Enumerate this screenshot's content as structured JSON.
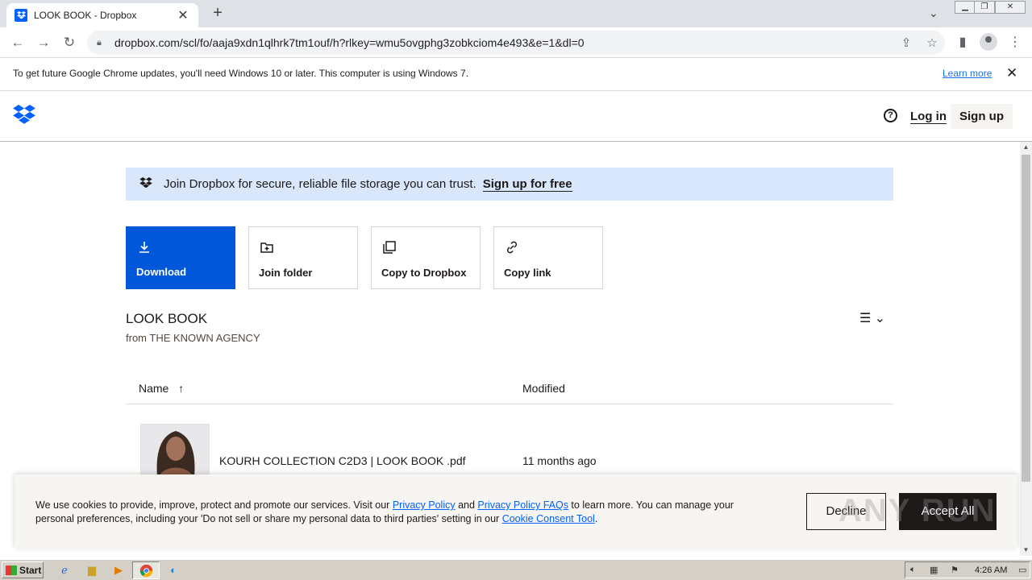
{
  "browser": {
    "tab_title": "LOOK BOOK - Dropbox",
    "tab_close": "✕",
    "new_tab": "+",
    "url": "dropbox.com/scl/fo/aaja9xdn1qlhrk7tm1ouf/h?rlkey=wmu5ovgphg3zobkciom4e493&e=1&dl=0",
    "infobar_message": "To get future Google Chrome updates, you'll need Windows 10 or later. This computer is using Windows 7.",
    "infobar_link": "Learn more"
  },
  "header": {
    "login": "Log in",
    "signup": "Sign up",
    "help": "?"
  },
  "banner": {
    "text": "Join Dropbox for secure, reliable file storage you can trust.",
    "cta": "Sign up for free"
  },
  "actions": {
    "download": "Download",
    "join_folder": "Join folder",
    "copy_to_dropbox": "Copy to Dropbox",
    "copy_link": "Copy link"
  },
  "folder": {
    "title": "LOOK BOOK",
    "from": "from THE KNOWN AGENCY"
  },
  "table": {
    "col_name": "Name",
    "col_modified": "Modified",
    "rows": [
      {
        "name": "KOURH COLLECTION C2D3 | LOOK BOOK .pdf",
        "modified": "11 months ago"
      }
    ]
  },
  "cookie": {
    "t1": "We use cookies to provide, improve, protect and promote our services. Visit our ",
    "link1": "Privacy Policy",
    "t2": " and ",
    "link2": "Privacy Policy FAQs",
    "t3": " to learn more. You can manage your personal preferences, including your 'Do not sell or share my personal data to third parties' setting in our ",
    "link3": "Cookie Consent Tool",
    "t4": ".",
    "decline": "Decline",
    "accept": "Accept All"
  },
  "watermark": "ANY RUN",
  "taskbar": {
    "start": "Start",
    "clock": "4:26 AM"
  },
  "colors": {
    "dropbox_blue": "#0061fe",
    "download_bg": "#0057d9",
    "banner_bg": "#d8e7fb",
    "accept_bg": "#1e1919"
  }
}
